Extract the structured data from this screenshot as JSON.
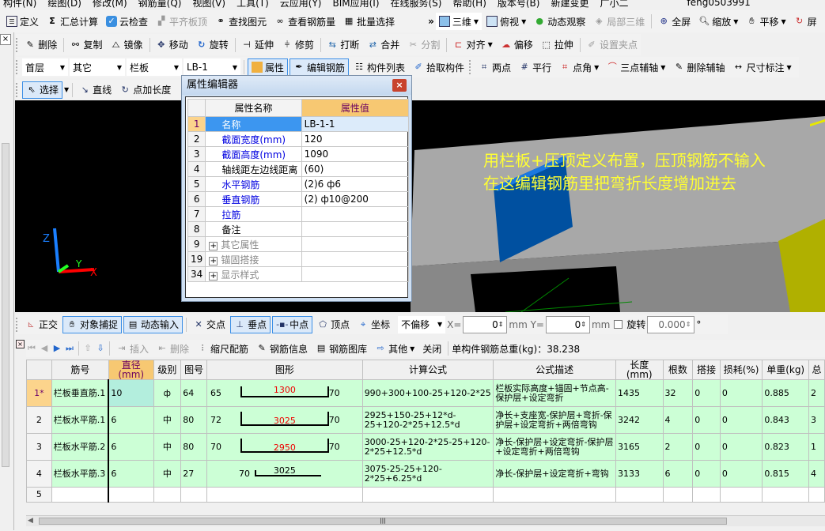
{
  "menu": [
    "构件(N)",
    "绘图(D)",
    "修改(M)",
    "钢筋量(Q)",
    "视图(V)",
    "工具(T)",
    "云应用(Y)",
    "BIM应用(I)",
    "在线服务(S)",
    "帮助(H)",
    "版本号(B)",
    "新建变更",
    "广小二",
    "feng0503991"
  ],
  "toolbar1": {
    "items": [
      "定义",
      "汇总计算",
      "云检查",
      "平齐板顶",
      "查找图元",
      "查看钢筋量",
      "批量选择"
    ],
    "more": "»",
    "view": [
      "三维",
      "俯视",
      "动态观察",
      "局部三维",
      "全屏",
      "缩放",
      "平移",
      "屏"
    ]
  },
  "toolbar2": [
    "删除",
    "复制",
    "镜像",
    "移动",
    "旋转",
    "延伸",
    "修剪",
    "打断",
    "合并",
    "分割",
    "对齐",
    "偏移",
    "拉伸",
    "设置夹点"
  ],
  "toolbar3": {
    "floor": "首层",
    "type": "其它",
    "category": "栏板",
    "component": "LB-1",
    "buttons": [
      "属性",
      "编辑钢筋",
      "构件列表",
      "拾取构件",
      "两点",
      "平行",
      "点角",
      "三点辅轴",
      "删除辅轴",
      "尺寸标注"
    ]
  },
  "toolbar4": [
    "选择",
    "直线",
    "点加长度"
  ],
  "viewport": {
    "annotation_line1": "用栏板+压顶定义布置，压顶钢筋不输入",
    "annotation_line2": "在这编辑钢筋里把弯折长度增加进去",
    "axis_x": "X",
    "axis_y": "Y",
    "axis_z": "Z",
    "colors": {
      "background": "#000000",
      "slab": "#0055a5",
      "wall": "#a8a8a8",
      "column": "#d8d800",
      "annotation": "#ffff33"
    }
  },
  "dialog": {
    "title": "属性编辑器",
    "col_name": "属性名称",
    "col_value": "属性值",
    "rows": [
      {
        "n": "1",
        "name": "名称",
        "value": "LB-1-1",
        "style": "blue"
      },
      {
        "n": "2",
        "name": "截面宽度(mm)",
        "value": "120",
        "style": "blue"
      },
      {
        "n": "3",
        "name": "截面高度(mm)",
        "value": "1090",
        "style": "blue"
      },
      {
        "n": "4",
        "name": "轴线距左边线距离",
        "value": "(60)",
        "style": ""
      },
      {
        "n": "5",
        "name": "水平钢筋",
        "value": "(2)6 ф6",
        "style": "blue"
      },
      {
        "n": "6",
        "name": "垂直钢筋",
        "value": "(2) ф10@200",
        "style": "blue"
      },
      {
        "n": "7",
        "name": "拉筋",
        "value": "",
        "style": "blue"
      },
      {
        "n": "8",
        "name": "备注",
        "value": "",
        "style": ""
      },
      {
        "n": "9",
        "name": "其它属性",
        "value": "",
        "style": "grey"
      },
      {
        "n": "19",
        "name": "锚固搭接",
        "value": "",
        "style": "grey"
      },
      {
        "n": "34",
        "name": "显示样式",
        "value": "",
        "style": "grey"
      }
    ]
  },
  "snapbar": {
    "items": [
      "正交",
      "对象捕捉",
      "动态输入",
      "交点",
      "垂点",
      "中点",
      "顶点",
      "坐标"
    ],
    "offset": "不偏移",
    "x_label": "X=",
    "x_value": "0",
    "y_label": "mm Y=",
    "y_value": "0",
    "mm": "mm",
    "rotate_label": "旋转",
    "rotate_value": "0.000",
    "degree": "°"
  },
  "rebarbar": {
    "items": [
      "插入",
      "删除",
      "缩尺配筋",
      "钢筋信息",
      "钢筋图库",
      "其他",
      "关闭"
    ],
    "total": "单构件钢筋总重(kg)：38.238"
  },
  "grid": {
    "headers": [
      "",
      "筋号",
      "直径(mm)",
      "级别",
      "图号",
      "图形",
      "计算公式",
      "公式描述",
      "长度(mm)",
      "根数",
      "搭接",
      "损耗(%)",
      "单重(kg)",
      "总"
    ],
    "rows": [
      {
        "rn": "1*",
        "name": "栏板垂直筋.1",
        "dia": "10",
        "grade": "ф",
        "fig": "64",
        "s_left": "65",
        "s_mid": "1300",
        "s_right": "70",
        "formula": "990+300+100-25+120-2*25",
        "desc": "栏板实际高度+锚固+节点高-保护层+设定弯折",
        "len": "1435",
        "count": "32",
        "lap": "0",
        "loss": "0",
        "unit": "0.885",
        "total": "2"
      },
      {
        "rn": "2",
        "name": "栏板水平筋.1",
        "dia": "6",
        "grade": "中",
        "fig": "80",
        "s_left": "72",
        "s_mid": "3025",
        "s_right": "70",
        "formula": "2925+150-25+12*d-25+120-2*25+12.5*d",
        "desc": "净长+支座宽-保护层+弯折-保护层+设定弯折+两倍弯钩",
        "len": "3242",
        "count": "4",
        "lap": "0",
        "loss": "0",
        "unit": "0.843",
        "total": "3"
      },
      {
        "rn": "3",
        "name": "栏板水平筋.2",
        "dia": "6",
        "grade": "中",
        "fig": "80",
        "s_left": "70",
        "s_mid": "2950",
        "s_right": "70",
        "formula": "3000-25+120-2*25-25+120-2*25+12.5*d",
        "desc": "净长-保护层+设定弯折-保护层+设定弯折+两倍弯钩",
        "len": "3165",
        "count": "2",
        "lap": "0",
        "loss": "0",
        "unit": "0.823",
        "total": "1"
      },
      {
        "rn": "4",
        "name": "栏板水平筋.3",
        "dia": "6",
        "grade": "中",
        "fig": "27",
        "s_left": "70",
        "s_mid": "3025",
        "s_right": "",
        "formula": "3075-25-25+120-2*25+6.25*d",
        "desc": "净长-保护层+设定弯折+弯钩",
        "len": "3133",
        "count": "6",
        "lap": "0",
        "loss": "0",
        "unit": "0.815",
        "total": "4"
      }
    ],
    "empty_row": "5"
  }
}
